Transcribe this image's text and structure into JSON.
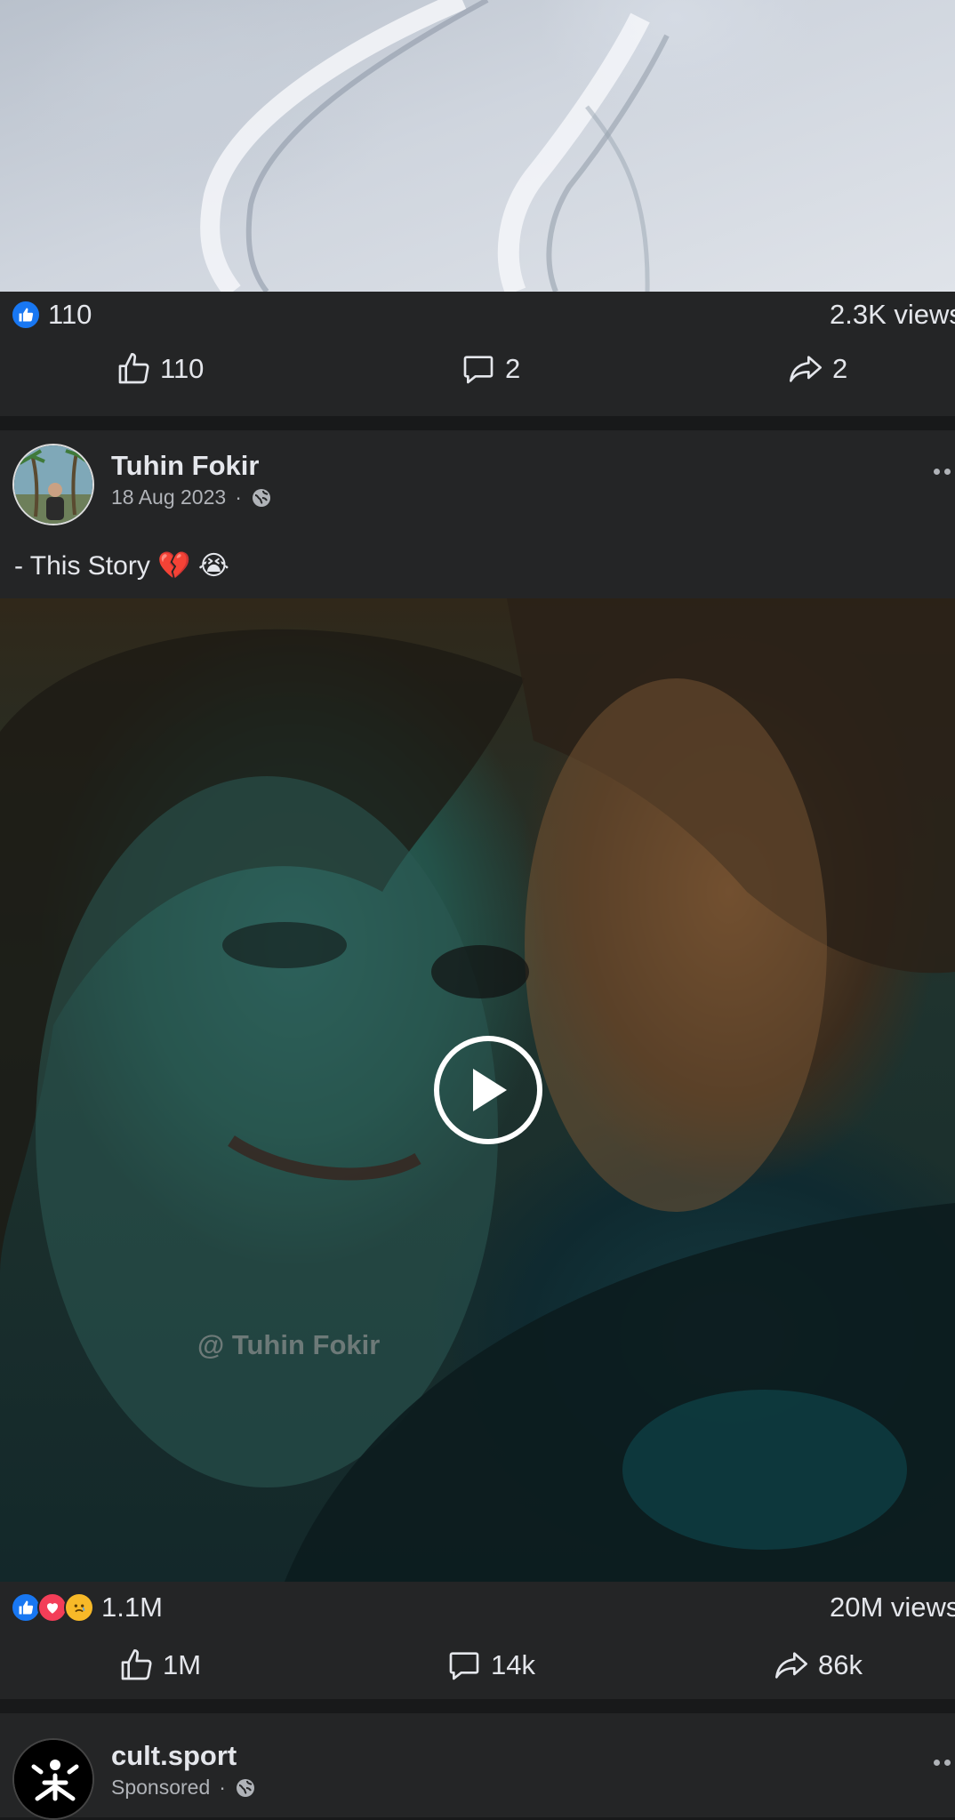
{
  "post1": {
    "reactions_count": "110",
    "views": "2.3K views",
    "like_count": "110",
    "comment_count": "2",
    "share_count": "2"
  },
  "post2": {
    "author": "Tuhin Fokir",
    "date": "18 Aug 2023",
    "separator": "·",
    "caption": "- This Story 💔 😭",
    "video_watermark": "@ Tuhin Fokir",
    "reactions_count": "1.1M",
    "views": "20M views",
    "like_count": "1M",
    "comment_count": "14k",
    "share_count": "86k"
  },
  "post3": {
    "author": "cult.sport",
    "label": "Sponsored",
    "separator": "·"
  },
  "colors": {
    "background": "#18191a",
    "card": "#242526",
    "text": "#e4e6eb",
    "secondary_text": "#b0b3b8",
    "like_blue": "#1877f2",
    "love_red": "#f33e58",
    "sad_yellow": "#f7b928"
  },
  "icons": [
    "like-icon",
    "comment-icon",
    "share-icon",
    "globe-icon",
    "play-icon",
    "more-icon"
  ]
}
